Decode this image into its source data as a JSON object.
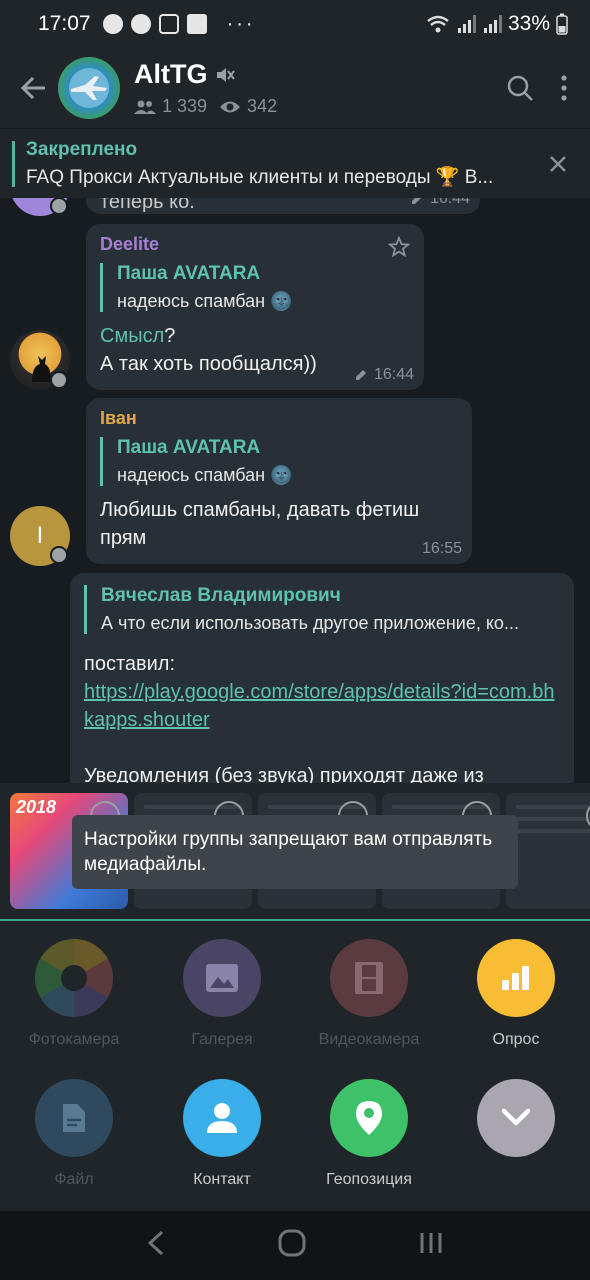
{
  "status_bar": {
    "time": "17:07",
    "more": "···",
    "battery": "33%"
  },
  "header": {
    "title": "AltTG",
    "members": "1 339",
    "online": "342"
  },
  "pinned": {
    "title": "Закреплено",
    "text": "FAQ  Прокси  Актуальные клиенты и переводы 🏆 В..."
  },
  "messages": [
    {
      "partial_time": "16:44",
      "partial_text": "теперь ко."
    },
    {
      "sender": "Deelite",
      "sender_color": "#a77fd4",
      "reply_name": "Паша AVATARA",
      "reply_text": "надеюсь спамбан 🌚",
      "body_link": "Смысл",
      "body_rest": "?",
      "body_line2": "А так хоть пообщался))",
      "time": "16:44"
    },
    {
      "sender": "Іван",
      "sender_color": "#e2a64a",
      "avatar_letter": "I",
      "reply_name": "Паша AVATARA",
      "reply_text": "надеюсь спамбан 🌚",
      "body": "Любишь спамбаны, давать фетиш прям",
      "time": "16:55"
    },
    {
      "reply_name": "Вячеслав Владимирович",
      "reply_text": "А что если использовать другое приложение, ко...",
      "body_pre": "поставил:",
      "link": "https://play.google.com/store/apps/details?id=com.bhkapps.shouter",
      "body_post": "Уведомления (без звука) приходят даже из"
    }
  ],
  "toast": "Настройки группы запрещают вам отправлять медиафайлы.",
  "attach_items": [
    {
      "label": "Фотокамера",
      "enabled": false,
      "color": "#3a4046"
    },
    {
      "label": "Галерея",
      "enabled": false,
      "color": "#4a4565"
    },
    {
      "label": "Видеокамера",
      "enabled": false,
      "color": "#5a3b40"
    },
    {
      "label": "Опрос",
      "enabled": true,
      "color": "#f6bd35"
    },
    {
      "label": "Файл",
      "enabled": false,
      "color": "#2f4a5e"
    },
    {
      "label": "Контакт",
      "enabled": true,
      "color": "#3aaee8"
    },
    {
      "label": "Геопозиция",
      "enabled": true,
      "color": "#3dc26a"
    },
    {
      "label": "",
      "enabled": true,
      "color": "#a9a6b0"
    }
  ],
  "thumb_badge": "2018"
}
